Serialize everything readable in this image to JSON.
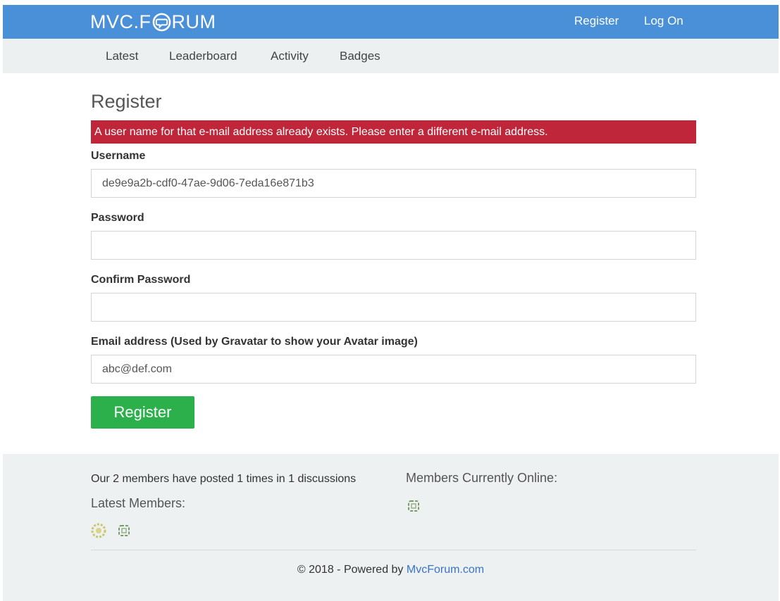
{
  "header": {
    "logo_left": "MVC.F",
    "logo_right": "RUM",
    "register_label": "Register",
    "logon_label": "Log On",
    "brand_color": "#4a90d9"
  },
  "nav": {
    "items": [
      {
        "label": "Latest"
      },
      {
        "label": "Leaderboard"
      },
      {
        "label": "Activity"
      },
      {
        "label": "Badges"
      }
    ]
  },
  "form": {
    "title": "Register",
    "error_message": "A user name for that e-mail address already exists. Please enter a different e-mail address.",
    "error_color": "#c0263a",
    "username_label": "Username",
    "username_value": "de9e9a2b-cdf0-47ae-9d06-7eda16e871b3",
    "password_label": "Password",
    "password_value": "",
    "confirm_label": "Confirm Password",
    "confirm_value": "",
    "email_label": "Email address (Used by Gravatar to show your Avatar image)",
    "email_value": "abc@def.com",
    "submit_label": "Register",
    "submit_color": "#2bb04c"
  },
  "footer": {
    "stats_text": "Our 2 members have posted 1 times in 1 discussions",
    "latest_members_label": "Latest Members:",
    "online_label": "Members Currently Online:",
    "copyright_prefix": "© 2018 - Powered by ",
    "copyright_link": "MvcForum.com"
  }
}
